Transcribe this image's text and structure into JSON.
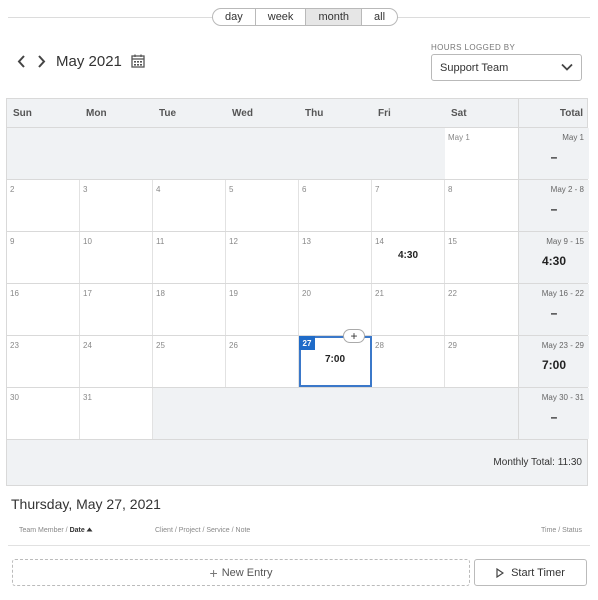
{
  "view_tabs": [
    {
      "label": "day",
      "active": false
    },
    {
      "label": "week",
      "active": false
    },
    {
      "label": "month",
      "active": true
    },
    {
      "label": "all",
      "active": false
    }
  ],
  "nav": {
    "prev_icon": "chevron-left-icon",
    "next_icon": "chevron-right-icon",
    "month_title": "May 2021",
    "calendar_icon": "calendar-icon"
  },
  "hours_logged": {
    "label": "HOURS LOGGED BY",
    "selected": "Support Team"
  },
  "calendar": {
    "headers": [
      "Sun",
      "Mon",
      "Tue",
      "Wed",
      "Thu",
      "Fri",
      "Sat",
      "Total"
    ],
    "weeks": [
      {
        "days": [
          null,
          null,
          null,
          null,
          null,
          null,
          {
            "label": "May 1",
            "hours": ""
          }
        ],
        "total_range": "May 1",
        "total": "–"
      },
      {
        "days": [
          {
            "label": "2",
            "hours": ""
          },
          {
            "label": "3",
            "hours": ""
          },
          {
            "label": "4",
            "hours": ""
          },
          {
            "label": "5",
            "hours": ""
          },
          {
            "label": "6",
            "hours": ""
          },
          {
            "label": "7",
            "hours": ""
          },
          {
            "label": "8",
            "hours": ""
          }
        ],
        "total_range": "May 2 - 8",
        "total": "–"
      },
      {
        "days": [
          {
            "label": "9",
            "hours": ""
          },
          {
            "label": "10",
            "hours": ""
          },
          {
            "label": "11",
            "hours": ""
          },
          {
            "label": "12",
            "hours": ""
          },
          {
            "label": "13",
            "hours": ""
          },
          {
            "label": "14",
            "hours": "4:30"
          },
          {
            "label": "15",
            "hours": ""
          }
        ],
        "total_range": "May 9 - 15",
        "total": "4:30"
      },
      {
        "days": [
          {
            "label": "16",
            "hours": ""
          },
          {
            "label": "17",
            "hours": ""
          },
          {
            "label": "18",
            "hours": ""
          },
          {
            "label": "19",
            "hours": ""
          },
          {
            "label": "20",
            "hours": ""
          },
          {
            "label": "21",
            "hours": ""
          },
          {
            "label": "22",
            "hours": ""
          }
        ],
        "total_range": "May 16 - 22",
        "total": "–"
      },
      {
        "days": [
          {
            "label": "23",
            "hours": ""
          },
          {
            "label": "24",
            "hours": ""
          },
          {
            "label": "25",
            "hours": ""
          },
          {
            "label": "26",
            "hours": ""
          },
          {
            "label": "27",
            "hours": "7:00",
            "selected": true
          },
          {
            "label": "28",
            "hours": ""
          },
          {
            "label": "29",
            "hours": ""
          }
        ],
        "total_range": "May 23 - 29",
        "total": "7:00"
      },
      {
        "days": [
          {
            "label": "30",
            "hours": ""
          },
          {
            "label": "31",
            "hours": ""
          },
          null,
          null,
          null,
          null,
          null
        ],
        "total_range": "May 30 - 31",
        "total": "–"
      }
    ],
    "add_entry_glyph": "+",
    "monthly_total": "Monthly Total: 11:30"
  },
  "day_detail": {
    "title": "Thursday, May 27, 2021",
    "col_member": "Team Member / ",
    "col_date": "Date",
    "sort_icon": "sort-ascending-icon",
    "col_cpsn": "Client / Project / Service / Note",
    "col_time": "Time / Status"
  },
  "actions": {
    "new_entry": "New Entry",
    "start_timer": "Start Timer"
  },
  "colors": {
    "accent": "#1f6bc8",
    "header_bg": "#f0f2f4"
  }
}
